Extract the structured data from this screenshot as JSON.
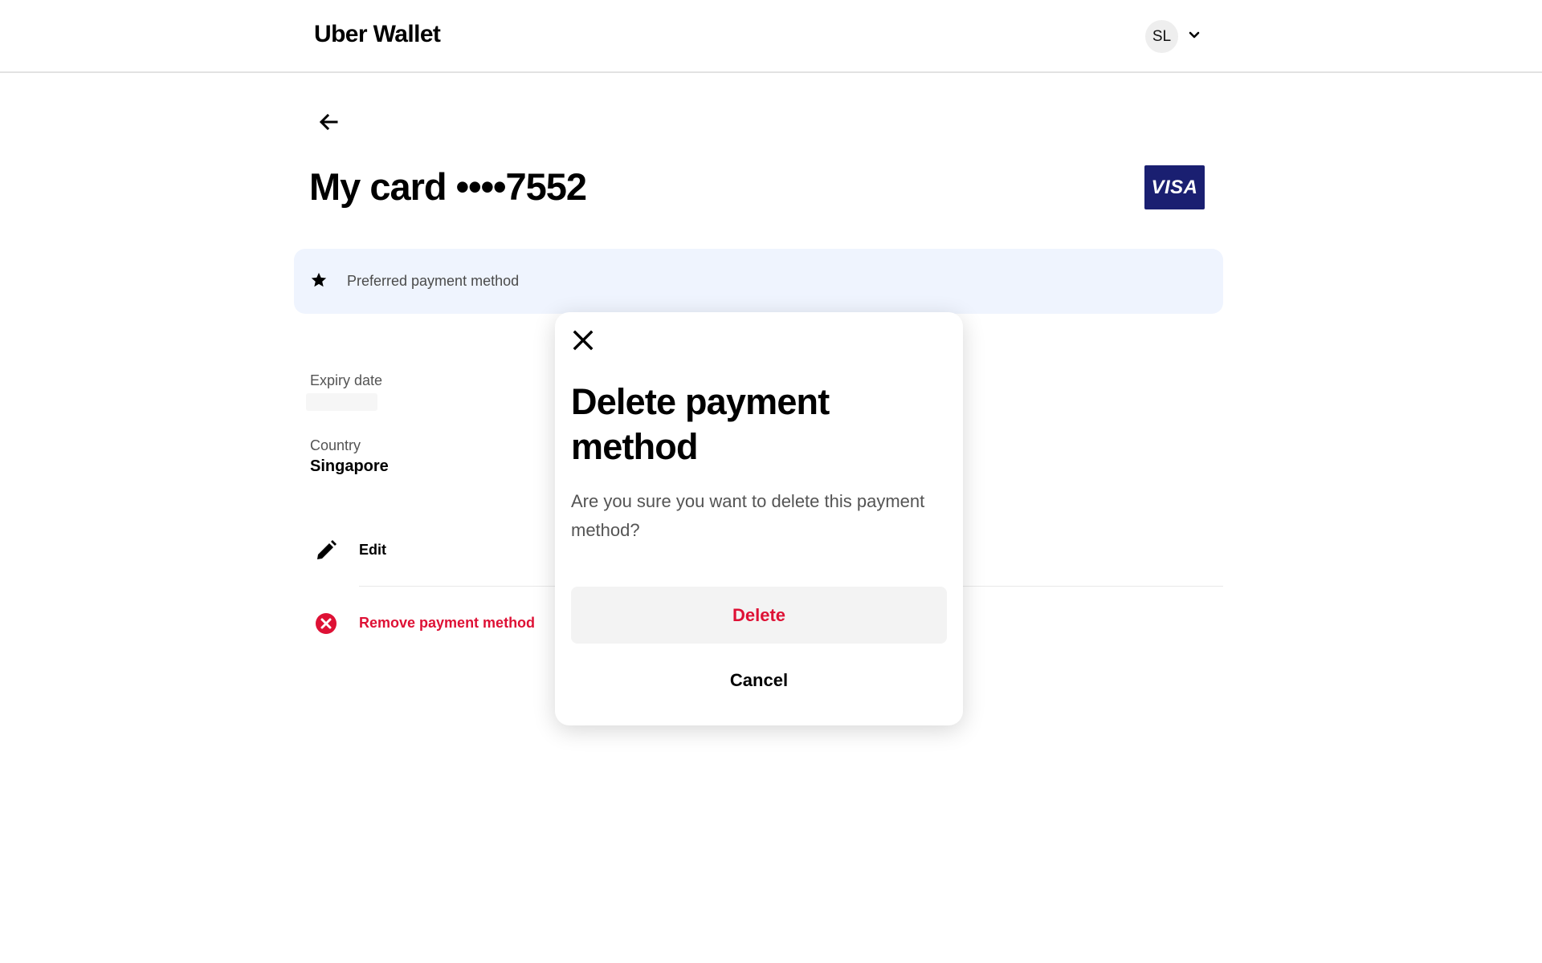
{
  "header": {
    "brand": "Uber Wallet",
    "avatar_initials": "SL"
  },
  "card": {
    "title": "My card ••••7552",
    "network": "VISA"
  },
  "preferred": {
    "label": "Preferred payment method"
  },
  "details": {
    "expiry_label": "Expiry date",
    "expiry_value": "",
    "country_label": "Country",
    "country_value": "Singapore"
  },
  "actions": {
    "edit_label": "Edit",
    "remove_label": "Remove payment method"
  },
  "modal": {
    "title": "Delete payment method",
    "message": "Are you sure you want to delete this payment method?",
    "delete_label": "Delete",
    "cancel_label": "Cancel"
  },
  "colors": {
    "danger": "#de1135",
    "banner_bg": "#eff4fe",
    "visa_blue": "#1a1f71"
  },
  "icons": {
    "back": "arrow-left-icon",
    "chevron": "chevron-down-icon",
    "star": "star-icon",
    "edit": "pencil-icon",
    "remove": "remove-circle-icon",
    "close": "close-icon"
  }
}
